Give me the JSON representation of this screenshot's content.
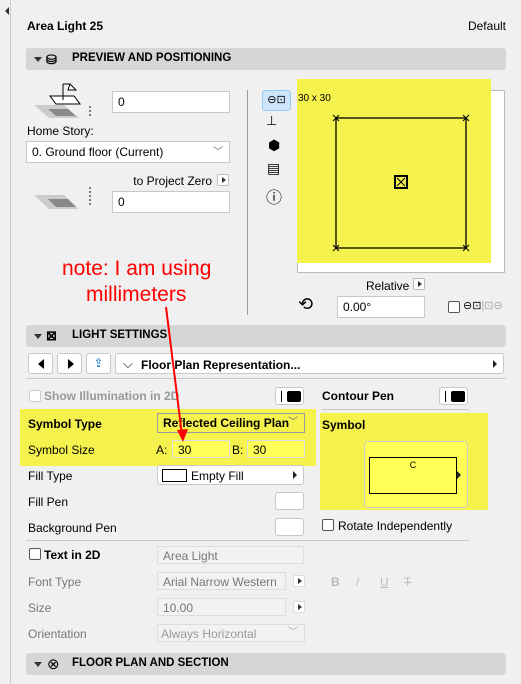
{
  "header": {
    "title": "Area Light 25",
    "preset": "Default"
  },
  "preview": {
    "section_title": "PREVIEW AND POSITIONING",
    "elevation_value": "0",
    "home_story_label": "Home Story:",
    "home_story_value": "0. Ground floor (Current)",
    "reference_label": "to Project Zero",
    "reference_value": "0",
    "preview_size_label": "30 x 30",
    "relative_label": "Relative",
    "rotation_value": "0.00°"
  },
  "annotation": {
    "line1": "note: I am using",
    "line2": "millimeters",
    "color": "#ff0000"
  },
  "light": {
    "section_title": "LIGHT SETTINGS",
    "page_selector": "Floor Plan Representation...",
    "show_illumination": "Show Illumination in 2D",
    "contour_pen": "Contour Pen",
    "symbol_type_label": "Symbol Type",
    "symbol_type_value": "Reflected Ceiling Plan",
    "symbol_size_label": "Symbol Size",
    "a_label": "A:",
    "a_value": "30",
    "b_label": "B:",
    "b_value": "30",
    "symbol_label": "Symbol",
    "symbol_letter": "C",
    "fill_type_label": "Fill Type",
    "fill_type_value": "Empty Fill",
    "fill_pen_label": "Fill Pen",
    "background_pen_label": "Background Pen",
    "rotate_label": "Rotate Independently",
    "text2d_label": "Text in 2D",
    "text2d_value": "Area Light",
    "font_type_label": "Font Type",
    "font_type_value": "Arial Narrow Western",
    "bold": "B",
    "italic": "/",
    "underline": "U",
    "strike": "T",
    "size_label": "Size",
    "size_value": "10.00",
    "orientation_label": "Orientation",
    "orientation_value": "Always Horizontal"
  },
  "floor": {
    "section_title": "FLOOR PLAN AND SECTION"
  },
  "colors": {
    "highlight": "#f5f24d",
    "header_bg": "#d6d6d6"
  }
}
